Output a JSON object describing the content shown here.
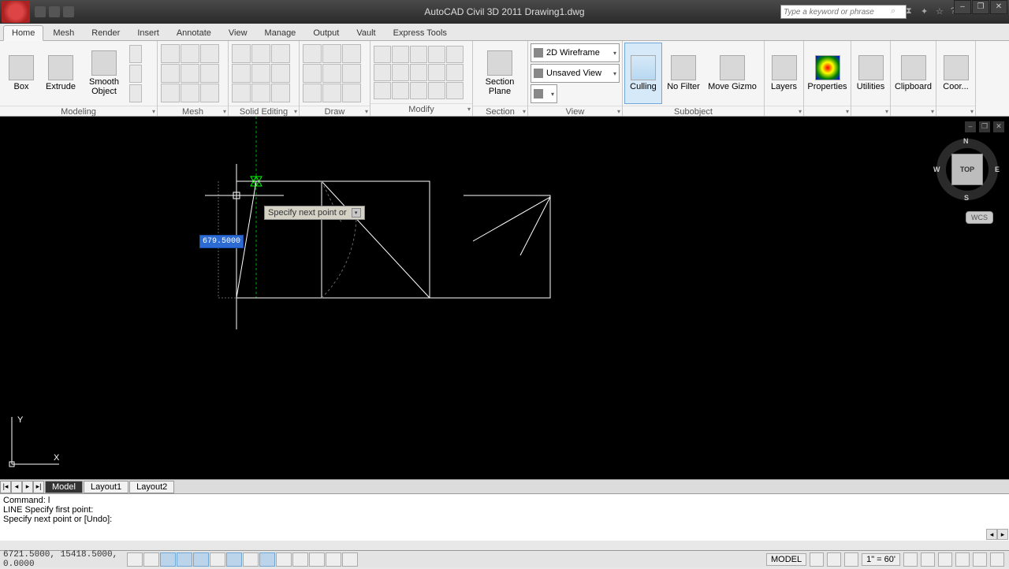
{
  "title": "AutoCAD Civil 3D 2011   Drawing1.dwg",
  "search_placeholder": "Type a keyword or phrase",
  "win": {
    "min": "–",
    "max": "❐",
    "close": "✕"
  },
  "tabs": [
    "Home",
    "Mesh",
    "Render",
    "Insert",
    "Annotate",
    "View",
    "Manage",
    "Output",
    "Vault",
    "Express Tools"
  ],
  "active_tab": "Home",
  "panels": {
    "modeling": {
      "title": "Modeling",
      "box": "Box",
      "extrude": "Extrude",
      "smooth": "Smooth Object"
    },
    "mesh": {
      "title": "Mesh"
    },
    "solid": {
      "title": "Solid Editing"
    },
    "draw": {
      "title": "Draw"
    },
    "modify": {
      "title": "Modify"
    },
    "section": {
      "title": "Section",
      "plane": "Section Plane",
      "visual": "2D Wireframe",
      "view_saved": "Unsaved View"
    },
    "view": {
      "title": "View"
    },
    "selection": {
      "title": "Subobject",
      "culling": "Culling",
      "nofilter": "No Filter",
      "gizmo": "Move Gizmo"
    },
    "layers": "Layers",
    "properties": "Properties",
    "utilities": "Utilities",
    "clipboard": "Clipboard",
    "coor": "Coor..."
  },
  "dynamic_input": {
    "value": "679.5000",
    "prompt": "Specify next point or"
  },
  "navcube": {
    "top": "TOP",
    "n": "N",
    "s": "S",
    "e": "E",
    "w": "W",
    "wcs": "WCS"
  },
  "bottom_tabs": {
    "model": "Model",
    "l1": "Layout1",
    "l2": "Layout2"
  },
  "command_lines": [
    "Command: l",
    "LINE Specify first point:",
    "Specify next point or [Undo]:"
  ],
  "status": {
    "coords": "6721.5000, 15418.5000, 0.0000",
    "model": "MODEL",
    "scale": "1\" = 60'"
  }
}
